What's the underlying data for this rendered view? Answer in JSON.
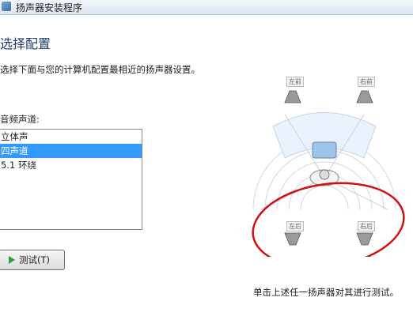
{
  "window": {
    "title": "扬声器安装程序"
  },
  "page": {
    "heading": "选择配置",
    "instruction": "选择下面与您的计算机配置最相近的扬声器设置。",
    "list_label": "音频声道:",
    "channels": [
      {
        "label": "立体声",
        "selected": false
      },
      {
        "label": "四声道",
        "selected": true
      },
      {
        "label": "5.1 环绕",
        "selected": false
      }
    ],
    "test_button": "测试(T)",
    "hint": "单击上述任一扬声器对其进行测试。"
  },
  "speakers": {
    "front_left": "左前",
    "front_right": "右前",
    "rear_left": "左后",
    "rear_right": "右后"
  },
  "colors": {
    "selection": "#3399ff",
    "annotation_ellipse": "#d01010",
    "heading": "#1e3a6e"
  }
}
